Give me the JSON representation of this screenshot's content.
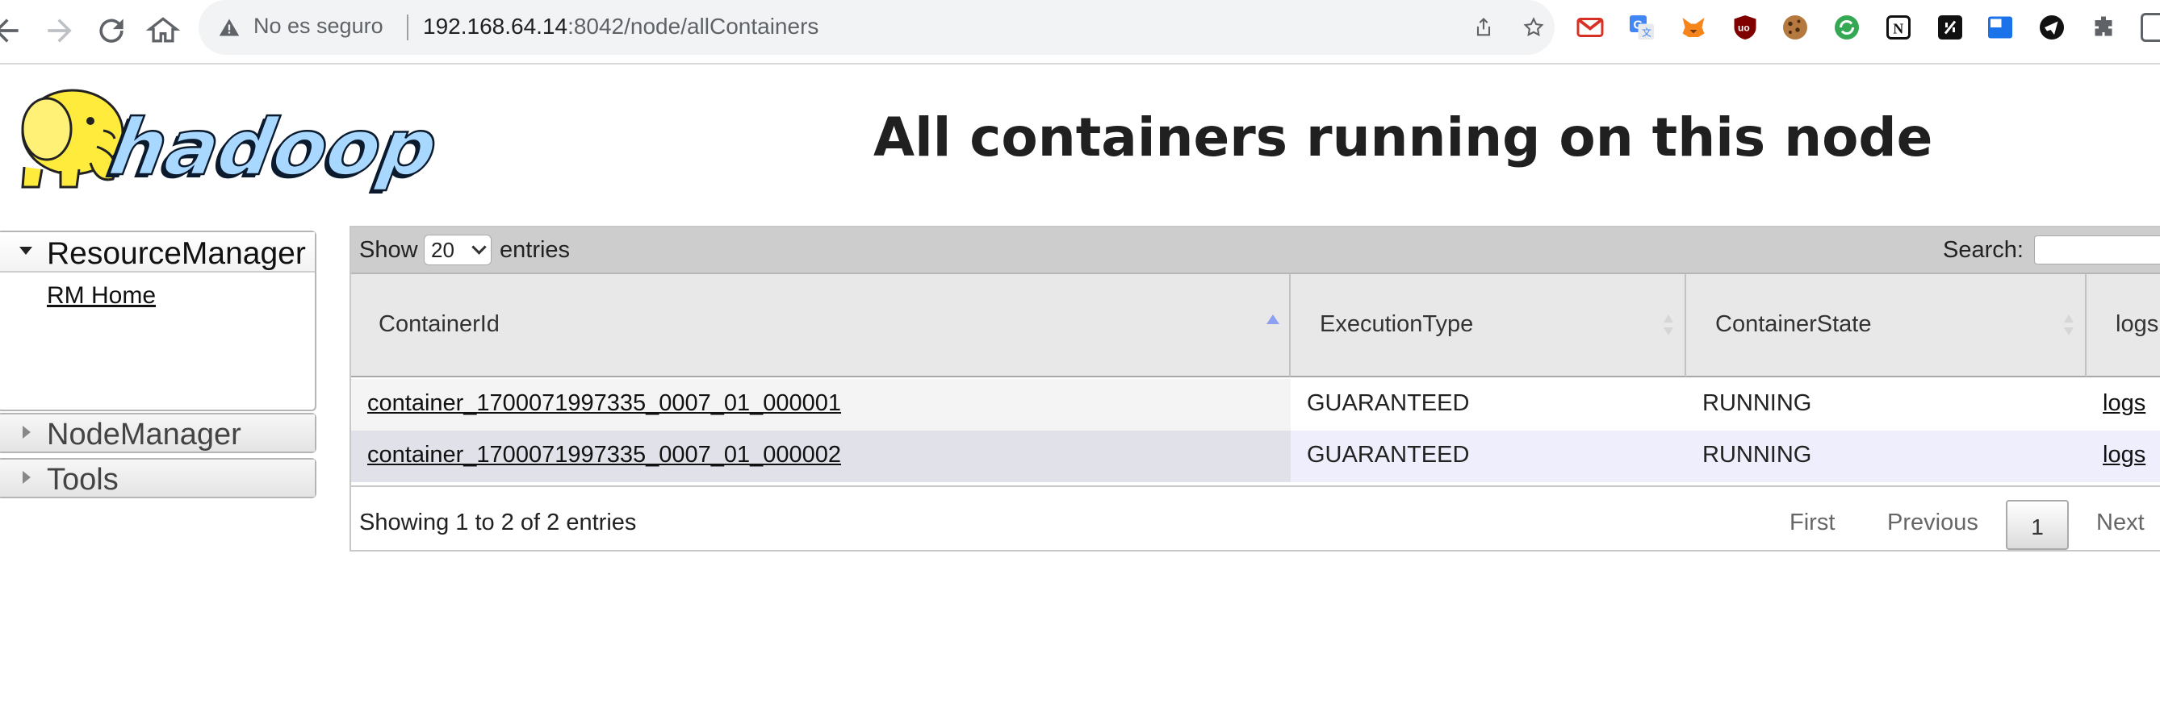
{
  "browser": {
    "security_label": "No es seguro",
    "url_host": "192.168.64.14",
    "url_rest": ":8042/node/allContainers",
    "extensions": [
      "gmail-icon",
      "translate-icon",
      "metamask-icon",
      "ublock-icon",
      "cookie-icon",
      "sync-icon",
      "notion-icon",
      "terminal-icon",
      "screen-icon",
      "telegram-icon",
      "puzzle-icon"
    ]
  },
  "header": {
    "logo_text": "hadoop",
    "title": "All containers running on this node"
  },
  "sidebar": {
    "sections": [
      {
        "label": "ResourceManager",
        "expanded": true,
        "links": [
          "RM Home"
        ]
      },
      {
        "label": "NodeManager",
        "expanded": false
      },
      {
        "label": "Tools",
        "expanded": false
      }
    ]
  },
  "table": {
    "show_label": "Show",
    "length_value": "20",
    "entries_label": "entries",
    "search_label": "Search:",
    "columns": [
      "ContainerId",
      "ExecutionType",
      "ContainerState",
      "logs"
    ],
    "rows": [
      {
        "id": "container_1700071997335_0007_01_000001",
        "type": "GUARANTEED",
        "state": "RUNNING",
        "logs": "logs"
      },
      {
        "id": "container_1700071997335_0007_01_000002",
        "type": "GUARANTEED",
        "state": "RUNNING",
        "logs": "logs"
      }
    ],
    "info": "Showing 1 to 2 of 2 entries",
    "pagination": {
      "first": "First",
      "previous": "Previous",
      "current": "1",
      "next": "Next"
    }
  },
  "colors": {
    "accent_sort": "#8da0f0",
    "row_even": "#eeeefc",
    "logo_blue": "#a8d8ff"
  }
}
